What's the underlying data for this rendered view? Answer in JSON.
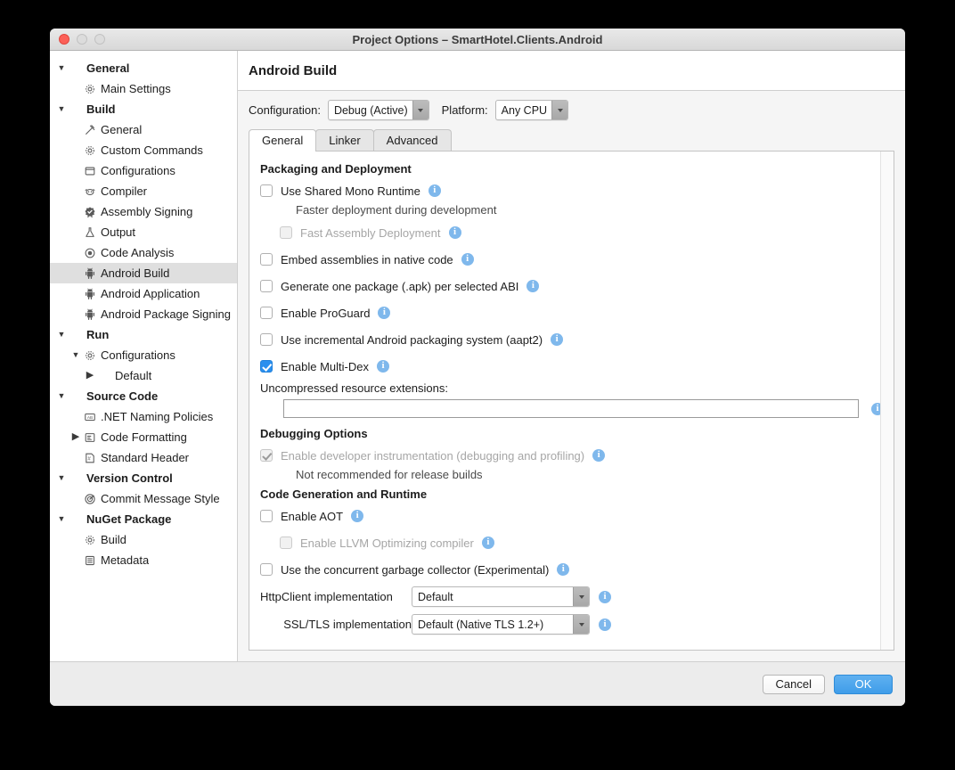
{
  "window": {
    "title": "Project Options – SmartHotel.Clients.Android",
    "traffic_lights": [
      "close-button",
      "minimize-button",
      "zoom-button"
    ]
  },
  "sidebar": {
    "items": [
      {
        "label": "General",
        "level": 0,
        "icon": "none",
        "disclosure": "down",
        "group": true,
        "selected": false
      },
      {
        "label": "Main Settings",
        "level": 1,
        "icon": "gear",
        "disclosure": "none",
        "group": false,
        "selected": false
      },
      {
        "label": "Build",
        "level": 0,
        "icon": "none",
        "disclosure": "down",
        "group": true,
        "selected": false
      },
      {
        "label": "General",
        "level": 1,
        "icon": "hammer",
        "disclosure": "none",
        "group": false,
        "selected": false
      },
      {
        "label": "Custom Commands",
        "level": 1,
        "icon": "gear",
        "disclosure": "none",
        "group": false,
        "selected": false
      },
      {
        "label": "Configurations",
        "level": 1,
        "icon": "square",
        "disclosure": "none",
        "group": false,
        "selected": false
      },
      {
        "label": "Compiler",
        "level": 1,
        "icon": "compiler",
        "disclosure": "none",
        "group": false,
        "selected": false
      },
      {
        "label": "Assembly Signing",
        "level": 1,
        "icon": "badge",
        "disclosure": "none",
        "group": false,
        "selected": false
      },
      {
        "label": "Output",
        "level": 1,
        "icon": "flask",
        "disclosure": "none",
        "group": false,
        "selected": false
      },
      {
        "label": "Code Analysis",
        "level": 1,
        "icon": "radio",
        "disclosure": "none",
        "group": false,
        "selected": false
      },
      {
        "label": "Android Build",
        "level": 1,
        "icon": "android",
        "disclosure": "none",
        "group": false,
        "selected": true
      },
      {
        "label": "Android Application",
        "level": 1,
        "icon": "android",
        "disclosure": "none",
        "group": false,
        "selected": false
      },
      {
        "label": "Android Package Signing",
        "level": 1,
        "icon": "android",
        "disclosure": "none",
        "group": false,
        "selected": false
      },
      {
        "label": "Run",
        "level": 0,
        "icon": "none",
        "disclosure": "down",
        "group": true,
        "selected": false
      },
      {
        "label": "Configurations",
        "level": 1,
        "icon": "gear",
        "disclosure": "down",
        "group": false,
        "selected": false
      },
      {
        "label": "Default",
        "level": 2,
        "icon": "none",
        "disclosure": "right",
        "group": false,
        "selected": false
      },
      {
        "label": "Source Code",
        "level": 0,
        "icon": "none",
        "disclosure": "down",
        "group": true,
        "selected": false
      },
      {
        "label": ".NET Naming Policies",
        "level": 1,
        "icon": "ab",
        "disclosure": "none",
        "group": false,
        "selected": false
      },
      {
        "label": "Code Formatting",
        "level": 1,
        "icon": "list",
        "disclosure": "right",
        "group": false,
        "selected": false
      },
      {
        "label": "Standard Header",
        "level": 1,
        "icon": "hash",
        "disclosure": "none",
        "group": false,
        "selected": false
      },
      {
        "label": "Version Control",
        "level": 0,
        "icon": "none",
        "disclosure": "down",
        "group": true,
        "selected": false
      },
      {
        "label": "Commit Message Style",
        "level": 1,
        "icon": "target",
        "disclosure": "none",
        "group": false,
        "selected": false
      },
      {
        "label": "NuGet Package",
        "level": 0,
        "icon": "none",
        "disclosure": "down",
        "group": true,
        "selected": false
      },
      {
        "label": "Build",
        "level": 1,
        "icon": "gear",
        "disclosure": "none",
        "group": false,
        "selected": false
      },
      {
        "label": "Metadata",
        "level": 1,
        "icon": "lines",
        "disclosure": "none",
        "group": false,
        "selected": false
      }
    ]
  },
  "main": {
    "title": "Android Build",
    "configuration_label": "Configuration:",
    "configuration_value": "Debug (Active)",
    "platform_label": "Platform:",
    "platform_value": "Any CPU",
    "tabs": [
      {
        "label": "General",
        "active": true
      },
      {
        "label": "Linker",
        "active": false
      },
      {
        "label": "Advanced",
        "active": false
      }
    ],
    "sections": {
      "packaging": {
        "title": "Packaging and Deployment",
        "use_shared_mono_runtime": "Use Shared Mono Runtime",
        "use_shared_mono_runtime_hint": "Faster deployment during development",
        "fast_assembly_deployment": "Fast Assembly Deployment",
        "embed_assemblies": "Embed assemblies in native code",
        "generate_one_package": "Generate one package (.apk) per selected ABI",
        "enable_proguard": "Enable ProGuard",
        "use_incremental_aapt2": "Use incremental Android packaging system (aapt2)",
        "enable_multi_dex": "Enable Multi-Dex",
        "uncompressed_label": "Uncompressed resource extensions:",
        "uncompressed_value": ""
      },
      "debugging": {
        "title": "Debugging Options",
        "enable_developer_instrumentation": "Enable developer instrumentation (debugging and profiling)",
        "enable_developer_instrumentation_hint": "Not recommended for release builds"
      },
      "codegen": {
        "title": "Code Generation and Runtime",
        "enable_aot": "Enable AOT",
        "enable_llvm": "Enable LLVM Optimizing compiler",
        "concurrent_gc": "Use the concurrent garbage collector (Experimental)",
        "httpclient_label": "HttpClient implementation",
        "httpclient_value": "Default",
        "ssltls_label": "SSL/TLS implementation",
        "ssltls_value": "Default (Native TLS 1.2+)"
      }
    }
  },
  "footer": {
    "cancel_label": "Cancel",
    "ok_label": "OK"
  },
  "colors": {
    "accent_blue": "#2a8fee",
    "ok_button": "#3f9de9",
    "info_icon": "#7fb8ec",
    "selection_grey": "#dfdfdf"
  }
}
